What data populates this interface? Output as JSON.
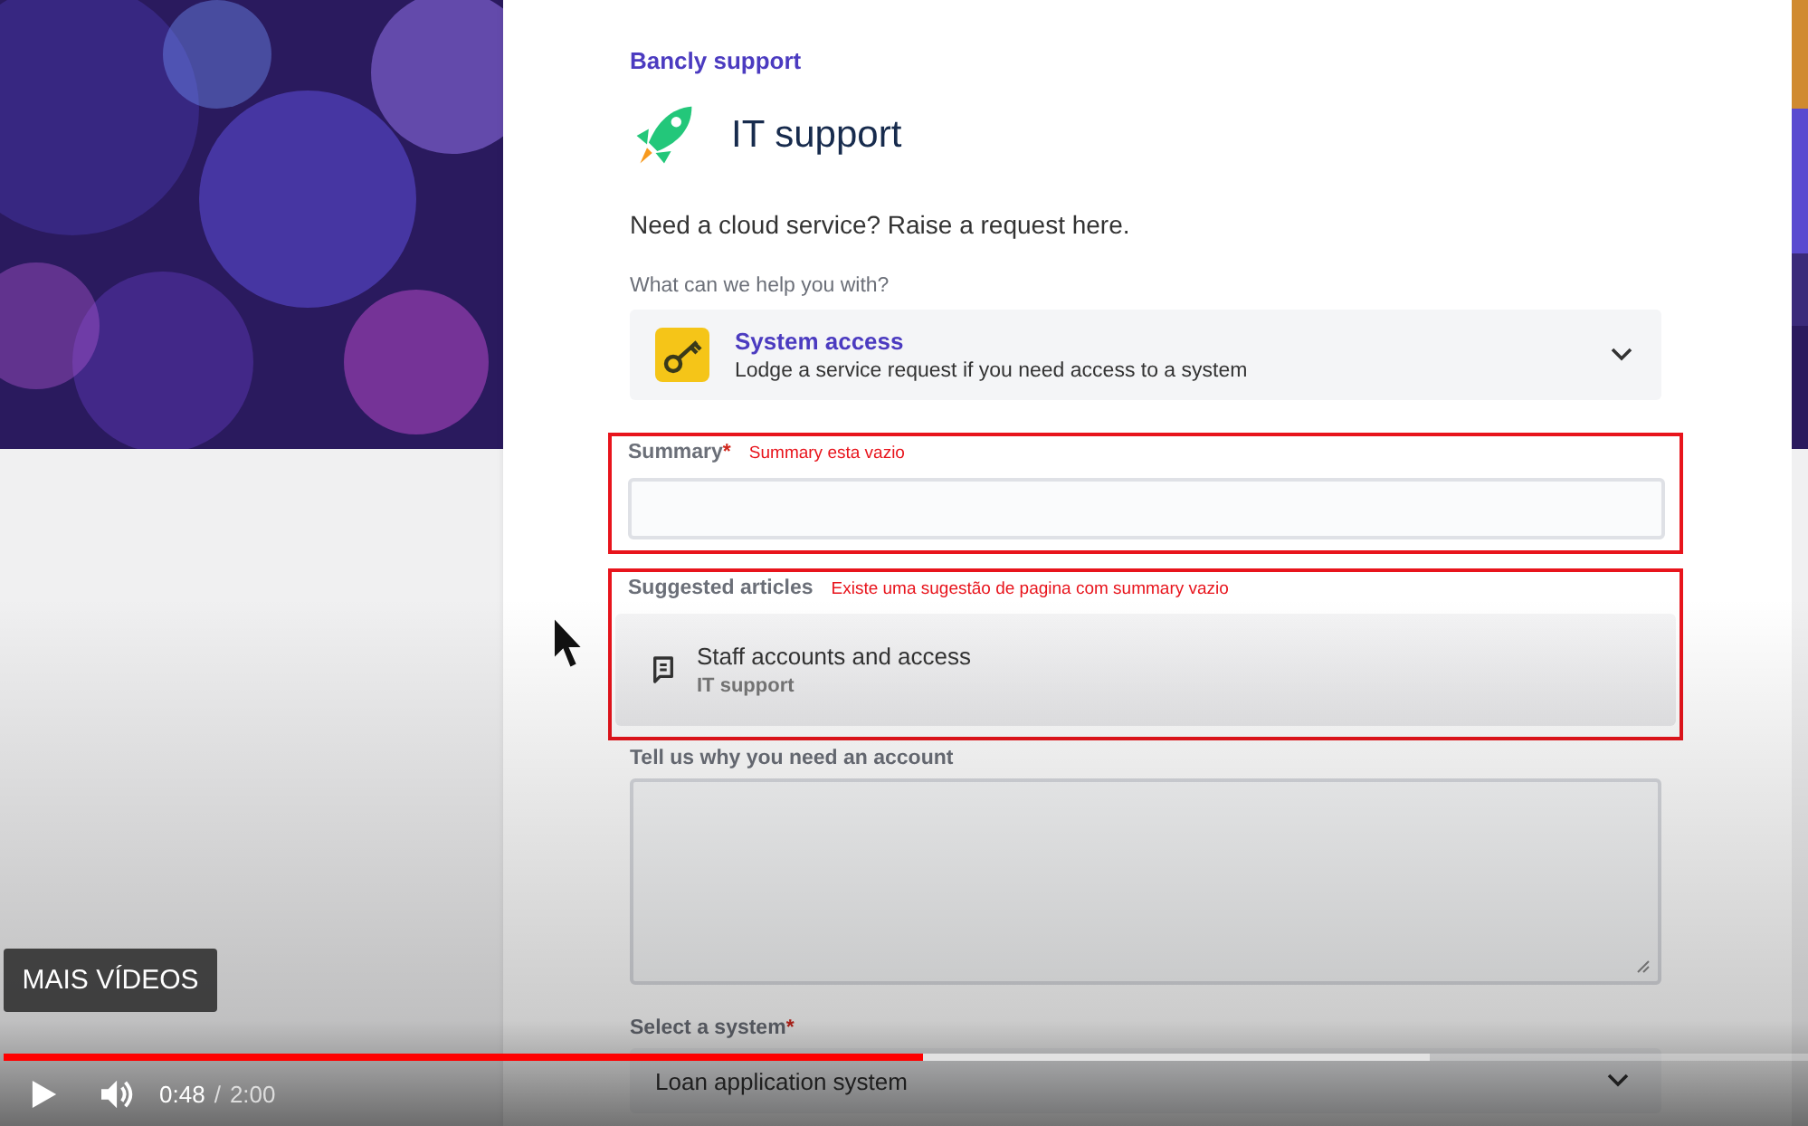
{
  "portal": {
    "breadcrumb": "Bancly support",
    "title": "IT support",
    "description": "Need a cloud service? Raise a request here.",
    "request_type_label": "What can we help you with?",
    "request_type": {
      "name": "System access",
      "description": "Lodge a service request if you need access to a system"
    },
    "summary": {
      "label": "Summary",
      "required_mark": "*",
      "annotation": "Summary esta vazio"
    },
    "suggested": {
      "label": "Suggested articles",
      "annotation": "Existe uma sugestão de pagina com summary vazio",
      "articles": [
        {
          "title": "Staff accounts and access",
          "source": "IT support"
        }
      ]
    },
    "reason": {
      "label": "Tell us why you need an account"
    },
    "system": {
      "label": "Select a system",
      "required_mark": "*",
      "value": "Loan application system"
    }
  },
  "video": {
    "more_button": "MAIS VÍDEOS",
    "current_time": "0:48",
    "time_separator": "/",
    "duration": "2:00",
    "progress": {
      "level": 0.51
    },
    "buffered": {
      "level": 0.79
    }
  }
}
